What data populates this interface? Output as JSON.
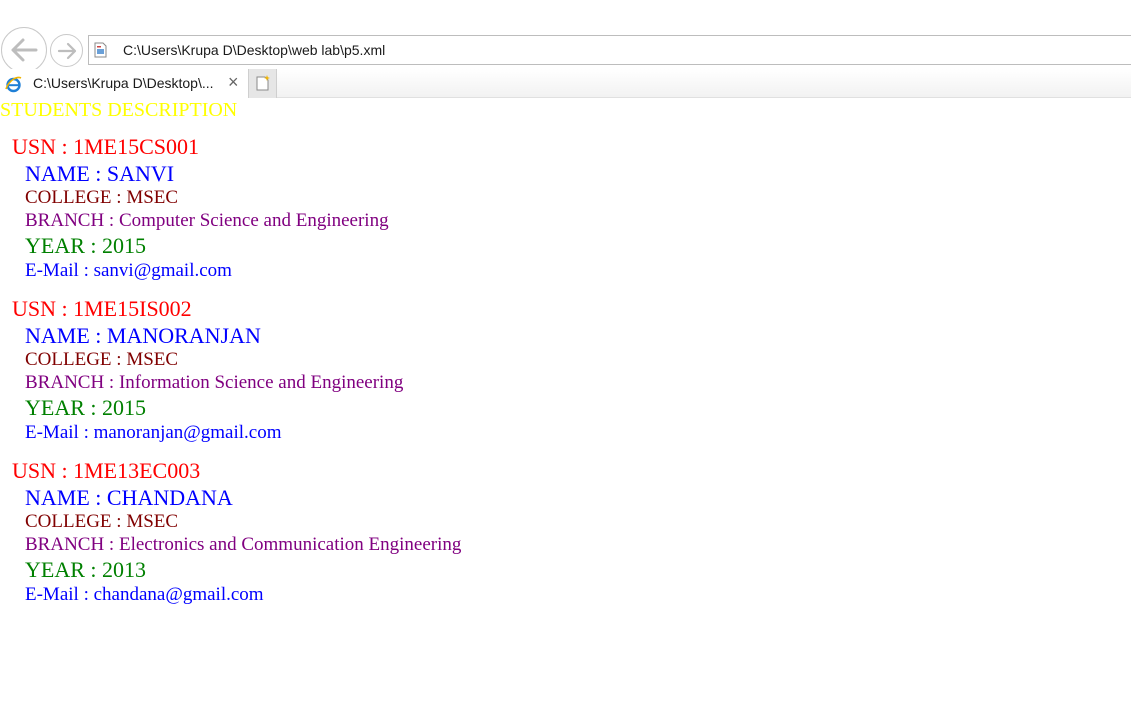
{
  "browser": {
    "address": "C:\\Users\\Krupa D\\Desktop\\web lab\\p5.xml",
    "tab_title": "C:\\Users\\Krupa D\\Desktop\\...",
    "tab_close_glyph": "×"
  },
  "page": {
    "heading": "STUDENTS DESCRIPTION",
    "students": [
      {
        "usn": "USN : 1ME15CS001",
        "name": "NAME : SANVI",
        "college": "COLLEGE : MSEC",
        "branch": "BRANCH : Computer Science and Engineering",
        "year": "YEAR : 2015",
        "email": "E-Mail : sanvi@gmail.com"
      },
      {
        "usn": "USN : 1ME15IS002",
        "name": "NAME : MANORANJAN",
        "college": "COLLEGE : MSEC",
        "branch": "BRANCH : Information Science and Engineering",
        "year": "YEAR : 2015",
        "email": "E-Mail : manoranjan@gmail.com"
      },
      {
        "usn": "USN : 1ME13EC003",
        "name": "NAME : CHANDANA",
        "college": "COLLEGE : MSEC",
        "branch": "BRANCH : Electronics and Communication Engineering",
        "year": "YEAR : 2013",
        "email": "E-Mail : chandana@gmail.com"
      }
    ]
  },
  "colors": {
    "heading": "#ffff00",
    "usn": "#ff0000",
    "name": "#0000ff",
    "college": "#800000",
    "branch": "#800080",
    "year": "#008000",
    "email": "#0000ff"
  },
  "icons": {
    "back": "back-arrow-icon",
    "forward": "forward-arrow-icon",
    "page": "xml-page-icon",
    "browser": "internet-explorer-icon",
    "new_tab": "new-tab-icon"
  }
}
